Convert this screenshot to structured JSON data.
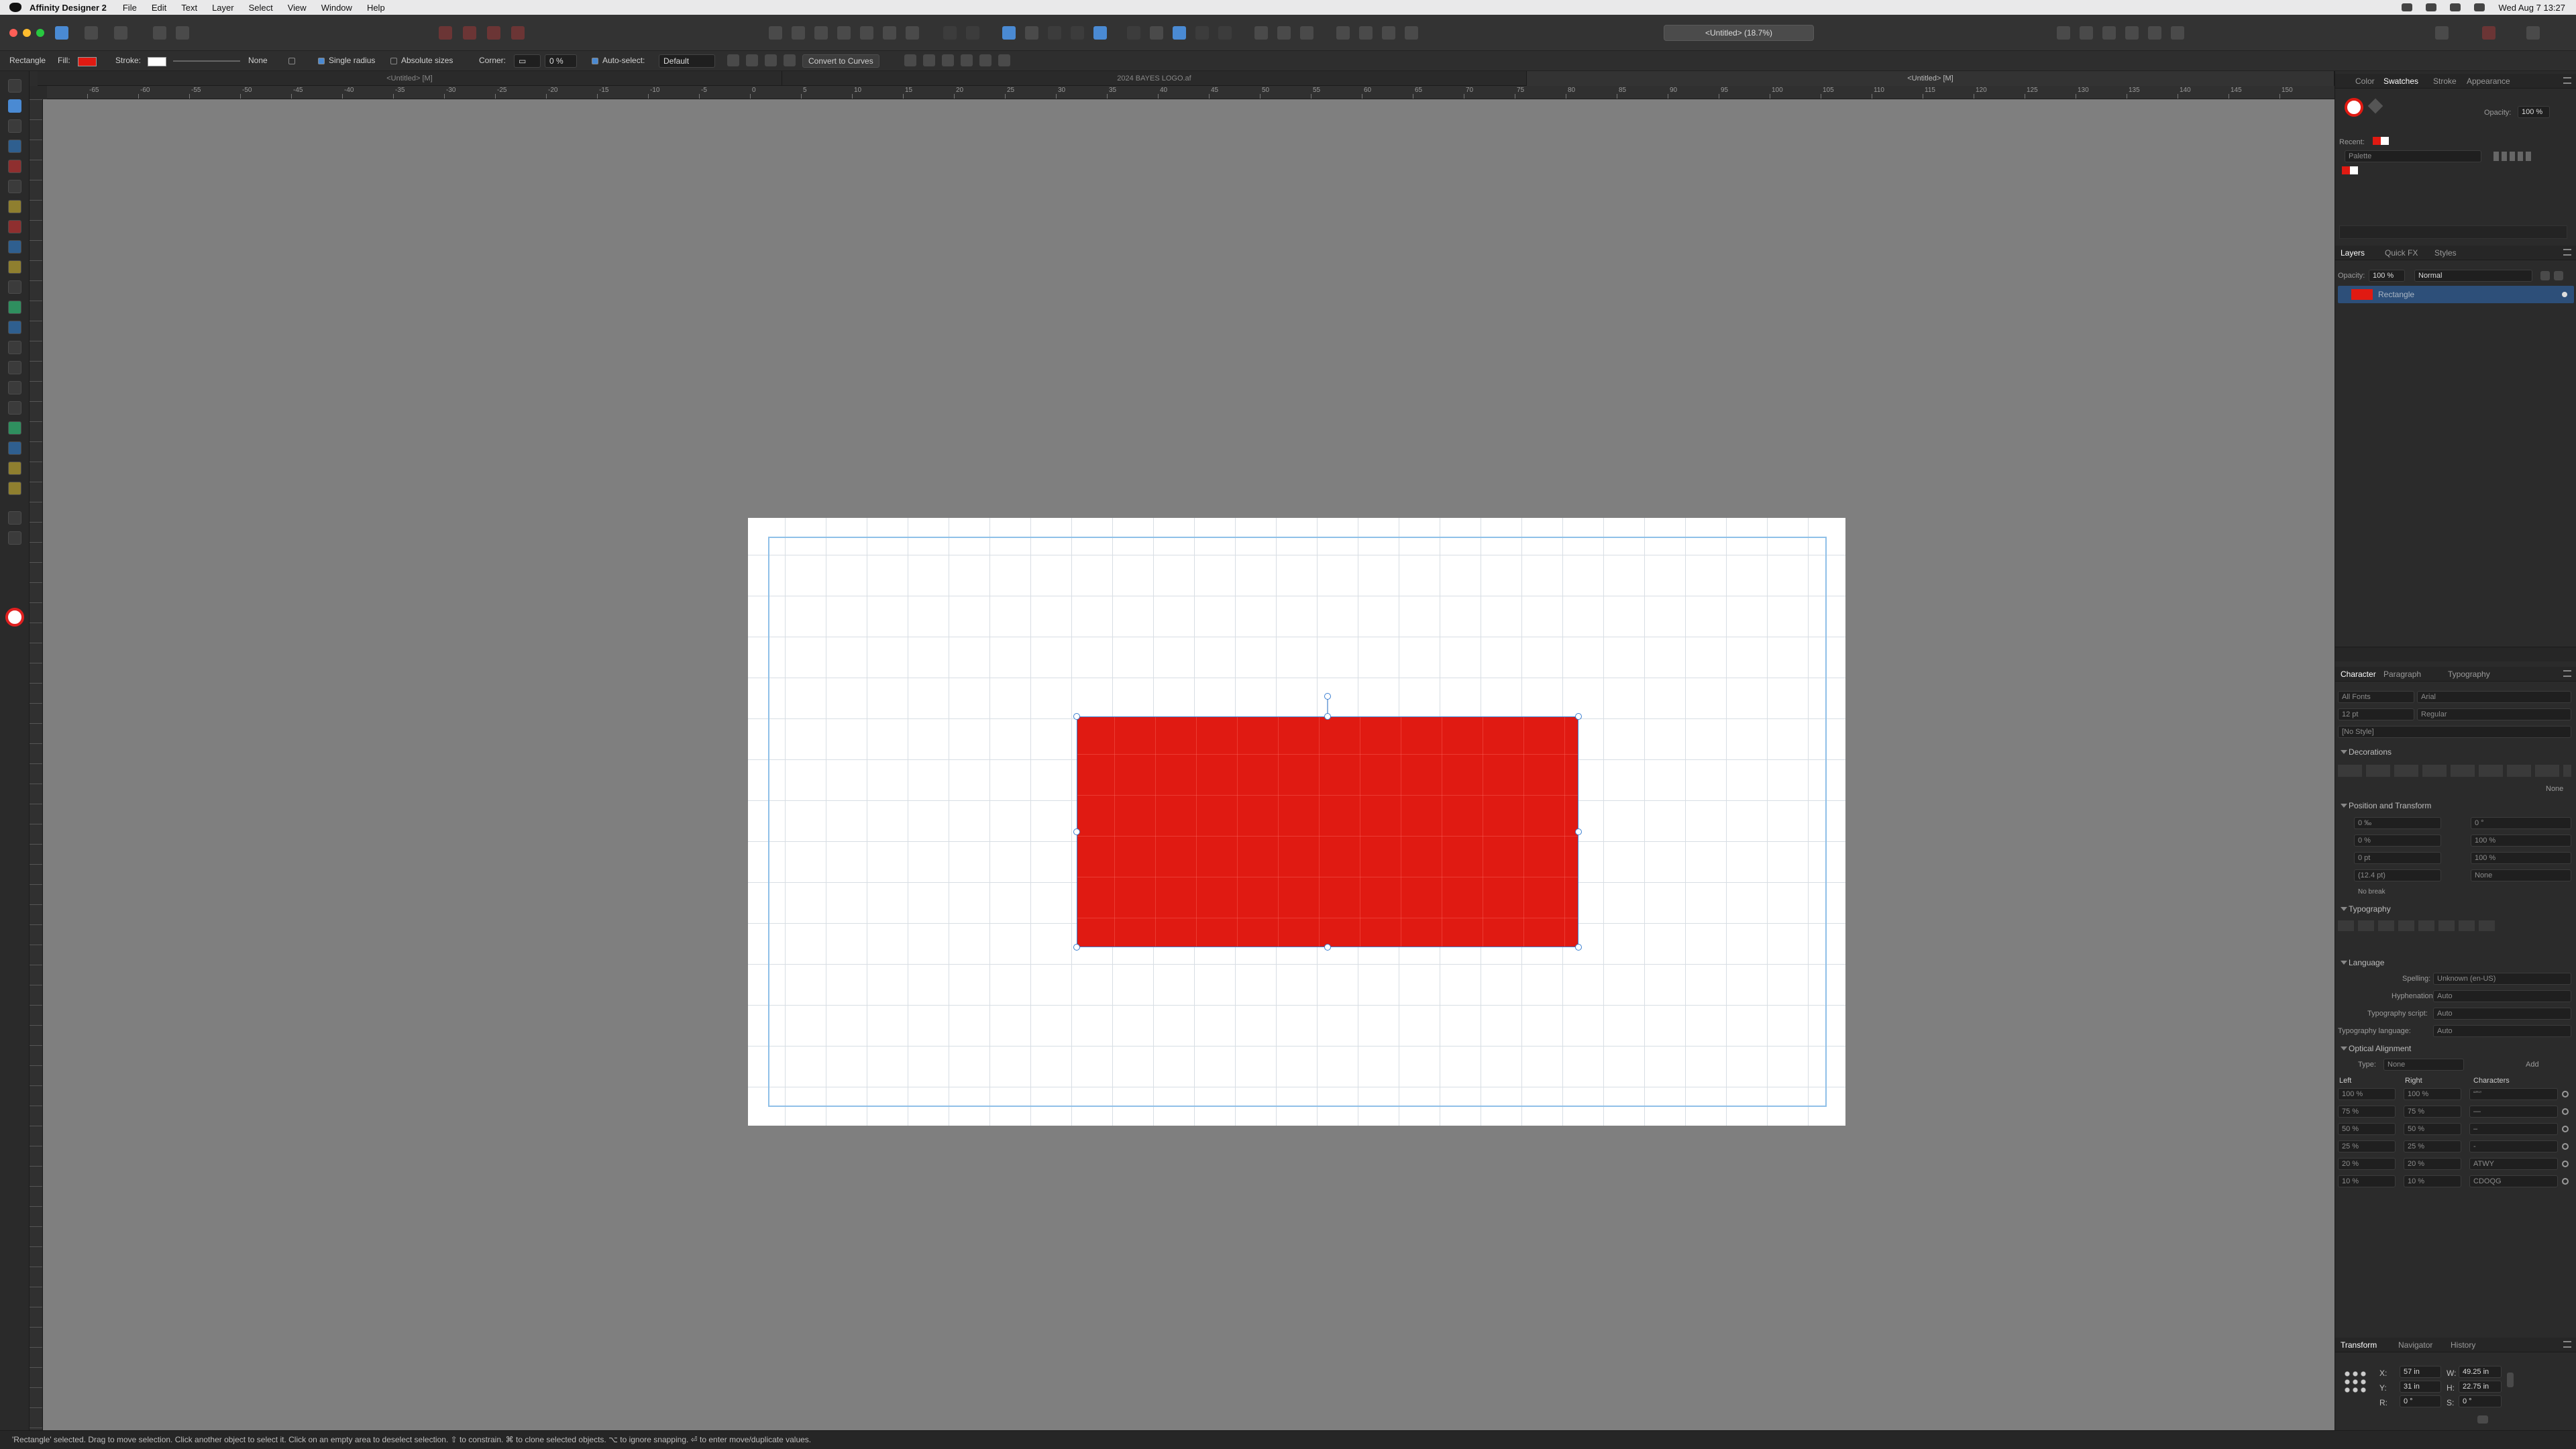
{
  "menubar": {
    "app_name": "Affinity Designer 2",
    "items": [
      "File",
      "Edit",
      "Text",
      "Layer",
      "Select",
      "View",
      "Window",
      "Help"
    ],
    "clock": "Wed Aug 7  13:27"
  },
  "toolbar": {
    "doc_selector": "<Untitled> (18.7%)"
  },
  "context": {
    "object_type": "Rectangle",
    "fill_label": "Fill:",
    "stroke_label": "Stroke:",
    "stroke_value": "None",
    "single_radius": "Single radius",
    "absolute_sizes": "Absolute sizes",
    "corner_label": "Corner:",
    "corner_value": "0 %",
    "auto_select": "Auto-select:",
    "auto_select_value": "Default",
    "convert_button": "Convert to Curves",
    "fill_color": "#e01a12"
  },
  "doc_tabs": [
    "<Untitled> [M]",
    "2024 BAYES LOGO.af",
    "<Untitled> [M]"
  ],
  "ruler": {
    "h_ticks": [
      "-65",
      "-60",
      "-55",
      "-50",
      "-45",
      "-40",
      "-35",
      "-30",
      "-25",
      "-20",
      "-15",
      "-10",
      "-5",
      "0",
      "5",
      "10",
      "15",
      "20",
      "25",
      "30",
      "35",
      "40",
      "45",
      "50",
      "55",
      "60",
      "65",
      "70",
      "75",
      "80",
      "85",
      "90",
      "95",
      "100",
      "105",
      "110",
      "115",
      "120",
      "125",
      "130",
      "135",
      "140",
      "145",
      "150"
    ]
  },
  "color_panel": {
    "tabs": [
      "Color",
      "Swatches",
      "Stroke",
      "Appearance"
    ],
    "active_tab": "Swatches",
    "opacity_label": "Opacity:",
    "opacity_value": "100 %",
    "recent_label": "Recent:",
    "palette_label": "Palette"
  },
  "layers_panel": {
    "tabs": [
      "Layers",
      "Quick FX",
      "Styles"
    ],
    "active_tab": "Layers",
    "opacity_label": "Opacity:",
    "opacity_value": "100 %",
    "blend_mode": "Normal",
    "layers": [
      {
        "name": "Rectangle",
        "color": "#e01a12"
      }
    ]
  },
  "character_panel": {
    "tabs": [
      "Character",
      "Paragraph",
      "Typography"
    ],
    "active_tab": "Character",
    "font_collection": "All Fonts",
    "font_family": "Arial",
    "font_size": "12 pt",
    "font_style": "Regular",
    "style": "[No Style]",
    "decorations_label": "Decorations",
    "decorations_value": "None",
    "position_label": "Position and Transform",
    "pos_left": [
      "0 ‰",
      "0 %",
      "0 pt",
      "(12.4 pt)"
    ],
    "pos_right": [
      "0 °",
      "100 %",
      "100 %",
      "None"
    ],
    "no_break": "No break",
    "typography_label": "Typography",
    "language_label": "Language",
    "spelling_label": "Spelling:",
    "spelling_value": "Unknown (en-US)",
    "hyphenation_label": "Hyphenation:",
    "hyphenation_value": "Auto",
    "script_label": "Typography script:",
    "script_value": "Auto",
    "lang_label": "Typography language:",
    "lang_value": "Auto",
    "optical_label": "Optical Alignment",
    "type_label": "Type:",
    "type_value": "None",
    "add_label": "Add",
    "col_left": "Left",
    "col_right": "Right",
    "col_chars": "Characters",
    "rows": [
      {
        "left": "100 %",
        "right": "100 %",
        "chars": "“”‘’"
      },
      {
        "left": "75 %",
        "right": "75 %",
        "chars": "—"
      },
      {
        "left": "50 %",
        "right": "50 %",
        "chars": "–"
      },
      {
        "left": "25 %",
        "right": "25 %",
        "chars": "-"
      },
      {
        "left": "20 %",
        "right": "20 %",
        "chars": "ATWY"
      },
      {
        "left": "10 %",
        "right": "10 %",
        "chars": "CDOQG"
      }
    ]
  },
  "transform_panel": {
    "tabs": [
      "Transform",
      "Navigator",
      "History"
    ],
    "active_tab": "Transform",
    "x_label": "X:",
    "x_value": "57 in",
    "y_label": "Y:",
    "y_value": "31 in",
    "w_label": "W:",
    "w_value": "49.25 in",
    "h_label": "H:",
    "h_value": "22.75 in",
    "r_label": "R:",
    "r_value": "0 °",
    "s_label": "S:",
    "s_value": "0 °"
  },
  "status": {
    "text": "'Rectangle' selected. Drag to move selection. Click another object to select it. Click on an empty area to deselect selection. ⇧ to constrain. ⌘ to clone selected objects. ⌥ to ignore snapping. ⏎ to enter move/duplicate values."
  }
}
